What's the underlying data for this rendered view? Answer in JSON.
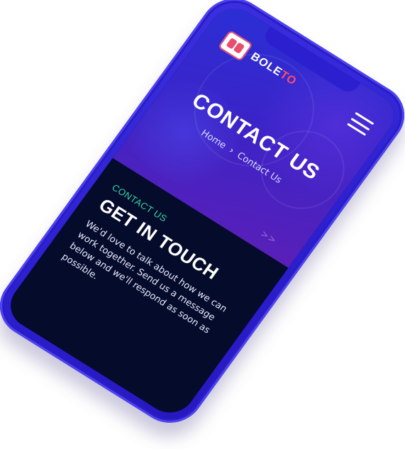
{
  "logo": {
    "text_primary": "BOLE",
    "text_accent": "TO"
  },
  "hero": {
    "title": "CONTACT US",
    "breadcrumb": {
      "home": "Home",
      "separator": "›",
      "current": "Contact Us"
    },
    "decor_arrows": ">>"
  },
  "contact": {
    "eyebrow": "CONTACT US",
    "heading": "GET IN TOUCH",
    "description": "We'd love to talk about how we can work together. Send us a message below and we'll respond as soon as possible."
  },
  "icons": {
    "menu": "hamburger-menu-icon",
    "logo": "boleto-ticket-logo-icon"
  },
  "colors": {
    "phone_frame": "#2b1fd0",
    "hero_gradient_start": "#2a2fd6",
    "hero_gradient_end": "#5a1fb8",
    "content_bg": "#050b2a",
    "accent_green": "#31d7a9",
    "accent_red": "#ff4b6e"
  }
}
